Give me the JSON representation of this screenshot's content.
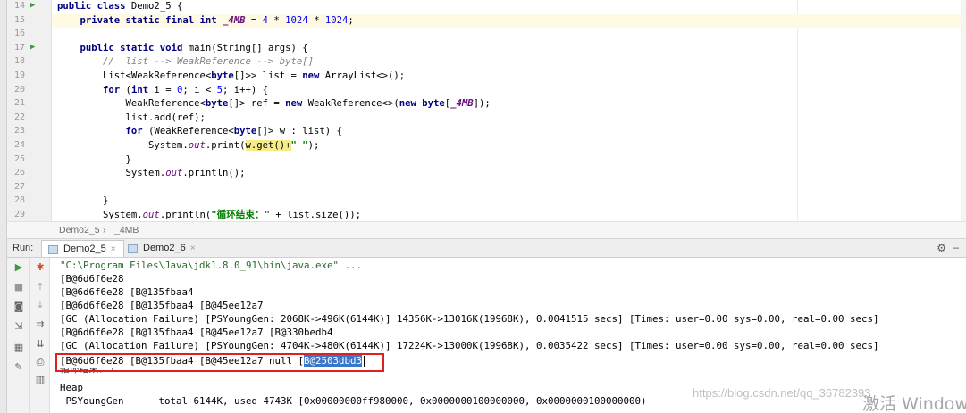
{
  "editor": {
    "lines": [
      {
        "n": "14",
        "run": true,
        "text": [
          {
            "t": "public class",
            "c": "kw"
          },
          {
            "t": " Demo2_5 {"
          }
        ]
      },
      {
        "n": "15",
        "text": [
          {
            "t": "    "
          },
          {
            "t": "private static final int",
            "c": "kw"
          },
          {
            "t": " "
          },
          {
            "t": "_4MB",
            "c": "fld"
          },
          {
            "t": " = "
          },
          {
            "t": "4",
            "c": "num"
          },
          {
            "t": " * "
          },
          {
            "t": "1024",
            "c": "num"
          },
          {
            "t": " * "
          },
          {
            "t": "1024",
            "c": "num"
          },
          {
            "t": ";"
          }
        ]
      },
      {
        "n": "16",
        "text": []
      },
      {
        "n": "17",
        "run": true,
        "text": [
          {
            "t": "    "
          },
          {
            "t": "public static void",
            "c": "kw"
          },
          {
            "t": " main(String[] args) {"
          }
        ]
      },
      {
        "n": "18",
        "text": [
          {
            "t": "        "
          },
          {
            "t": "//  list --> WeakReference --> byte[]",
            "c": "cmt"
          }
        ]
      },
      {
        "n": "19",
        "text": [
          {
            "t": "        List<WeakReference<"
          },
          {
            "t": "byte",
            "c": "kw"
          },
          {
            "t": "[]>> list = "
          },
          {
            "t": "new",
            "c": "kw"
          },
          {
            "t": " ArrayList<>();"
          }
        ]
      },
      {
        "n": "20",
        "text": [
          {
            "t": "        "
          },
          {
            "t": "for",
            "c": "kw"
          },
          {
            "t": " ("
          },
          {
            "t": "int",
            "c": "kw"
          },
          {
            "t": " i = "
          },
          {
            "t": "0",
            "c": "num"
          },
          {
            "t": "; i < "
          },
          {
            "t": "5",
            "c": "num"
          },
          {
            "t": "; i++) {"
          }
        ]
      },
      {
        "n": "21",
        "text": [
          {
            "t": "            WeakReference<"
          },
          {
            "t": "byte",
            "c": "kw"
          },
          {
            "t": "[]> ref = "
          },
          {
            "t": "new",
            "c": "kw"
          },
          {
            "t": " WeakReference<>("
          },
          {
            "t": "new",
            "c": "kw"
          },
          {
            "t": " "
          },
          {
            "t": "byte",
            "c": "kw"
          },
          {
            "t": "["
          },
          {
            "t": "_4MB",
            "c": "fld"
          },
          {
            "t": "]);"
          }
        ]
      },
      {
        "n": "22",
        "text": [
          {
            "t": "            list.add(ref);"
          }
        ]
      },
      {
        "n": "23",
        "text": [
          {
            "t": "            "
          },
          {
            "t": "for",
            "c": "kw"
          },
          {
            "t": " (WeakReference<"
          },
          {
            "t": "byte",
            "c": "kw"
          },
          {
            "t": "[]> w : list) {"
          }
        ]
      },
      {
        "n": "24",
        "text": [
          {
            "t": "                System."
          },
          {
            "t": "out",
            "c": "sfld"
          },
          {
            "t": ".print("
          },
          {
            "t": "w.get()+",
            "c": "hl"
          },
          {
            "t": "\" \"",
            "c": "str"
          },
          {
            "t": ");"
          }
        ]
      },
      {
        "n": "25",
        "text": [
          {
            "t": "            }"
          }
        ]
      },
      {
        "n": "26",
        "text": [
          {
            "t": "            System."
          },
          {
            "t": "out",
            "c": "sfld"
          },
          {
            "t": ".println();"
          }
        ]
      },
      {
        "n": "27",
        "text": []
      },
      {
        "n": "28",
        "text": [
          {
            "t": "        }"
          }
        ]
      },
      {
        "n": "29",
        "text": [
          {
            "t": "        System."
          },
          {
            "t": "out",
            "c": "sfld"
          },
          {
            "t": ".println("
          },
          {
            "t": "\"循环结束：\"",
            "c": "str"
          },
          {
            "t": " + list.size());"
          }
        ]
      }
    ]
  },
  "breadcrumb": {
    "item1": "Demo2_5",
    "sep": "›",
    "item2": "_4MB"
  },
  "run_panel": {
    "label": "Run:",
    "tabs": [
      {
        "label": "Demo2_5",
        "close": "×"
      },
      {
        "label": "Demo2_6",
        "close": "×"
      }
    ],
    "gear": "⚙",
    "minimize": "–"
  },
  "console": {
    "command": "\"C:\\Program Files\\Java\\jdk1.8.0_91\\bin\\java.exe\" ...",
    "lines": [
      "[B@6d6f6e28",
      "[B@6d6f6e28 [B@135fbaa4",
      "[B@6d6f6e28 [B@135fbaa4 [B@45ee12a7",
      "[GC (Allocation Failure) [PSYoungGen: 2068K->496K(6144K)] 14356K->13016K(19968K), 0.0041515 secs] [Times: user=0.00 sys=0.00, real=0.00 secs]",
      "[B@6d6f6e28 [B@135fbaa4 [B@45ee12a7 [B@330bedb4",
      "[GC (Allocation Failure) [PSYoungGen: 4704K->480K(6144K)] 17224K->13000K(19968K), 0.0035422 secs] [Times: user=0.00 sys=0.00, real=0.00 secs]"
    ],
    "highlight_prefix": "[B@6d6f6e28 [B@135fbaa4 [B@45ee12a7 null [",
    "highlight_selected": "B@2503dbd3",
    "loop_end": "循环结束：5",
    "heap": "Heap",
    "young_gen": " PSYoungGen      total 6144K, used 4743K [0x00000000ff980000, 0x0000000100000000, 0x0000000100000000)"
  },
  "overlay": {
    "watermark": "https://blog.csdn.net/qq_36782393",
    "activate": "激活 Windows"
  },
  "colors": {
    "keyword": "#000080",
    "string": "#008000",
    "number": "#0000ff",
    "selection": "#3a76c9",
    "red_box": "#e02020"
  }
}
